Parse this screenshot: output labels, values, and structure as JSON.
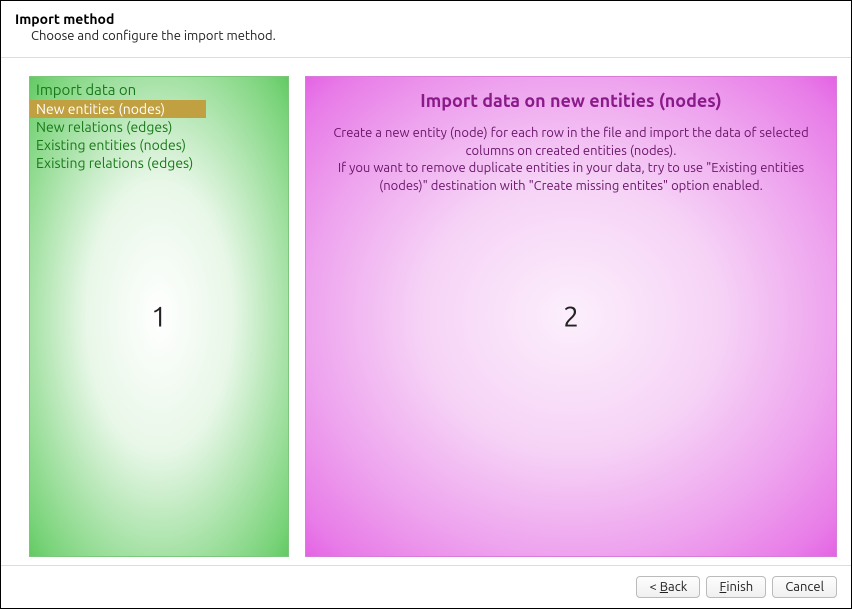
{
  "header": {
    "title": "Import method",
    "subtitle": "Choose and configure the import method."
  },
  "left_panel": {
    "header": "Import data on",
    "items": [
      {
        "label": "New entities (nodes)",
        "selected": true
      },
      {
        "label": "New relations (edges)",
        "selected": false
      },
      {
        "label": "Existing entities (nodes)",
        "selected": false
      },
      {
        "label": "Existing relations (edges)",
        "selected": false
      }
    ],
    "number": "1"
  },
  "right_panel": {
    "title": "Import data on new entities (nodes)",
    "body_line1": "Create a new entity (node) for each row in the file and import the data of selected columns on created entities (nodes).",
    "body_line2": "If you want to remove duplicate entities in your data, try to use \"Existing entities (nodes)\" destination with \"Create missing entites\" option enabled.",
    "number": "2"
  },
  "footer": {
    "back_prefix": "< ",
    "back_mnemonic": "B",
    "back_rest": "ack",
    "finish_mnemonic": "F",
    "finish_rest": "inish",
    "cancel": "Cancel"
  }
}
